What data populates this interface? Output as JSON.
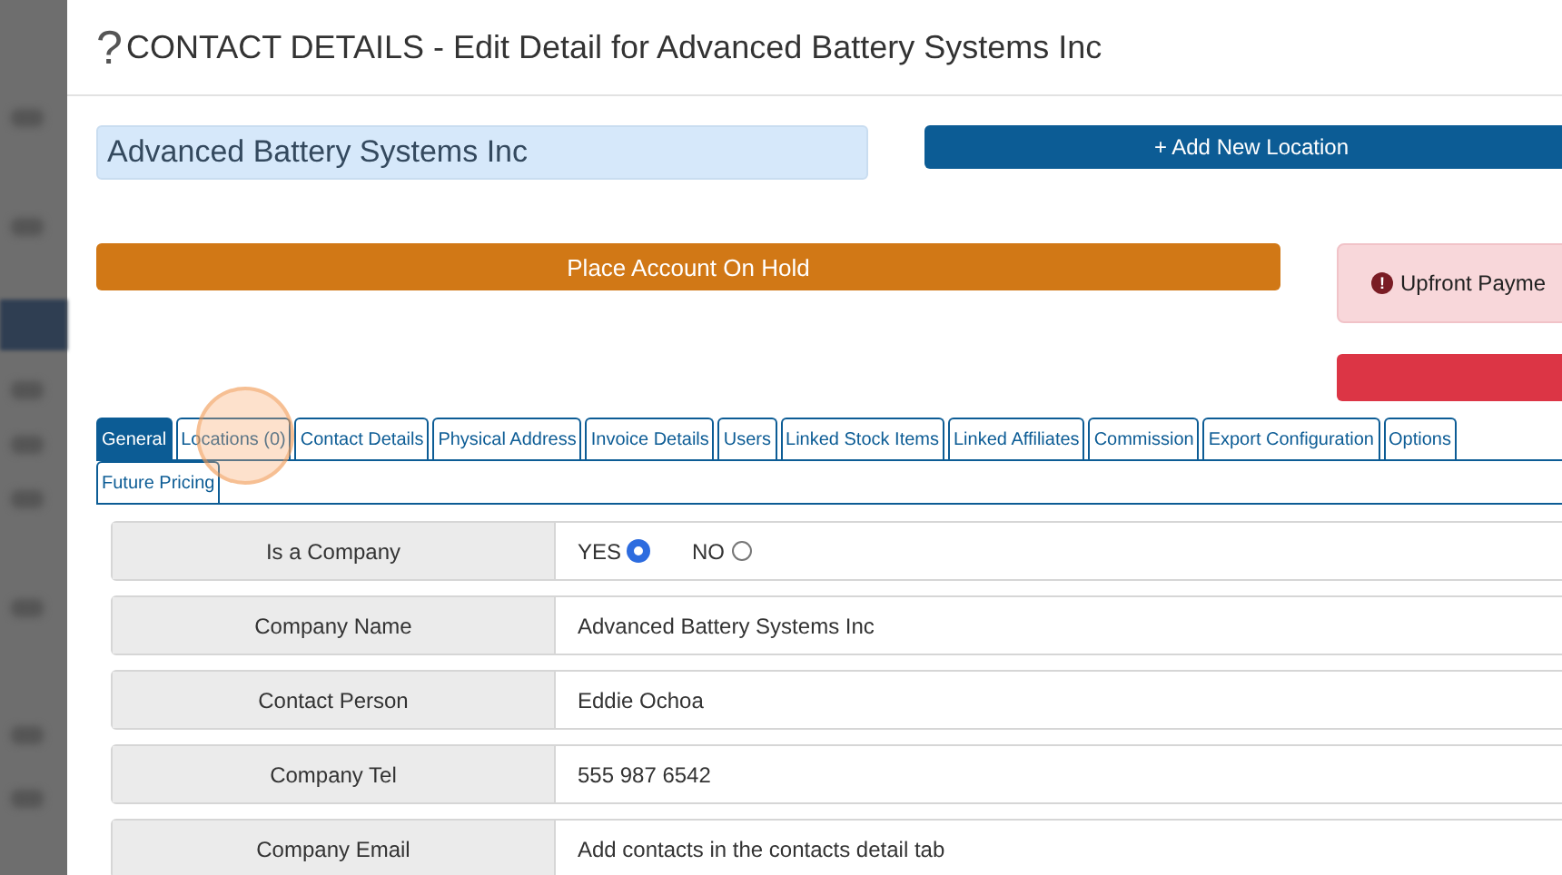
{
  "dialog": {
    "help_glyph": "?",
    "title": "CONTACT DETAILS - Edit Detail for Advanced Battery Systems Inc"
  },
  "name_field": {
    "value": "Advanced Battery Systems Inc"
  },
  "add_location_button": {
    "icon": "+",
    "label": "Add New Location"
  },
  "hold_button": {
    "label": "Place Account On Hold"
  },
  "alert": {
    "icon": "!",
    "text": "Upfront Payme"
  },
  "tab_rows": [
    [
      {
        "label": "General",
        "selected": true
      },
      {
        "label": "Locations (0)",
        "selected": false
      },
      {
        "label": "Contact Details",
        "selected": false
      },
      {
        "label": "Physical Address",
        "selected": false
      },
      {
        "label": "Invoice Details",
        "selected": false
      },
      {
        "label": "Users",
        "selected": false
      },
      {
        "label": "Linked Stock Items",
        "selected": false
      },
      {
        "label": "Linked Affiliates",
        "selected": false
      },
      {
        "label": "Commission",
        "selected": false
      },
      {
        "label": "Export Configuration",
        "selected": false
      },
      {
        "label": "Options",
        "selected": false
      }
    ],
    [
      {
        "label": "Future Pricing",
        "selected": false
      }
    ]
  ],
  "fields": [
    {
      "kind": "radio",
      "label": "Is a Company",
      "options": [
        {
          "label": "YES",
          "selected": true
        },
        {
          "label": "NO",
          "selected": false
        }
      ]
    },
    {
      "kind": "text",
      "label": "Company Name",
      "value": "Advanced Battery Systems Inc"
    },
    {
      "kind": "text",
      "label": "Contact Person",
      "value": "Eddie Ochoa"
    },
    {
      "kind": "text",
      "label": "Company Tel",
      "value": "555 987 6542"
    },
    {
      "kind": "text",
      "label": "Company Email",
      "value": "Add contacts in the contacts detail tab"
    }
  ]
}
